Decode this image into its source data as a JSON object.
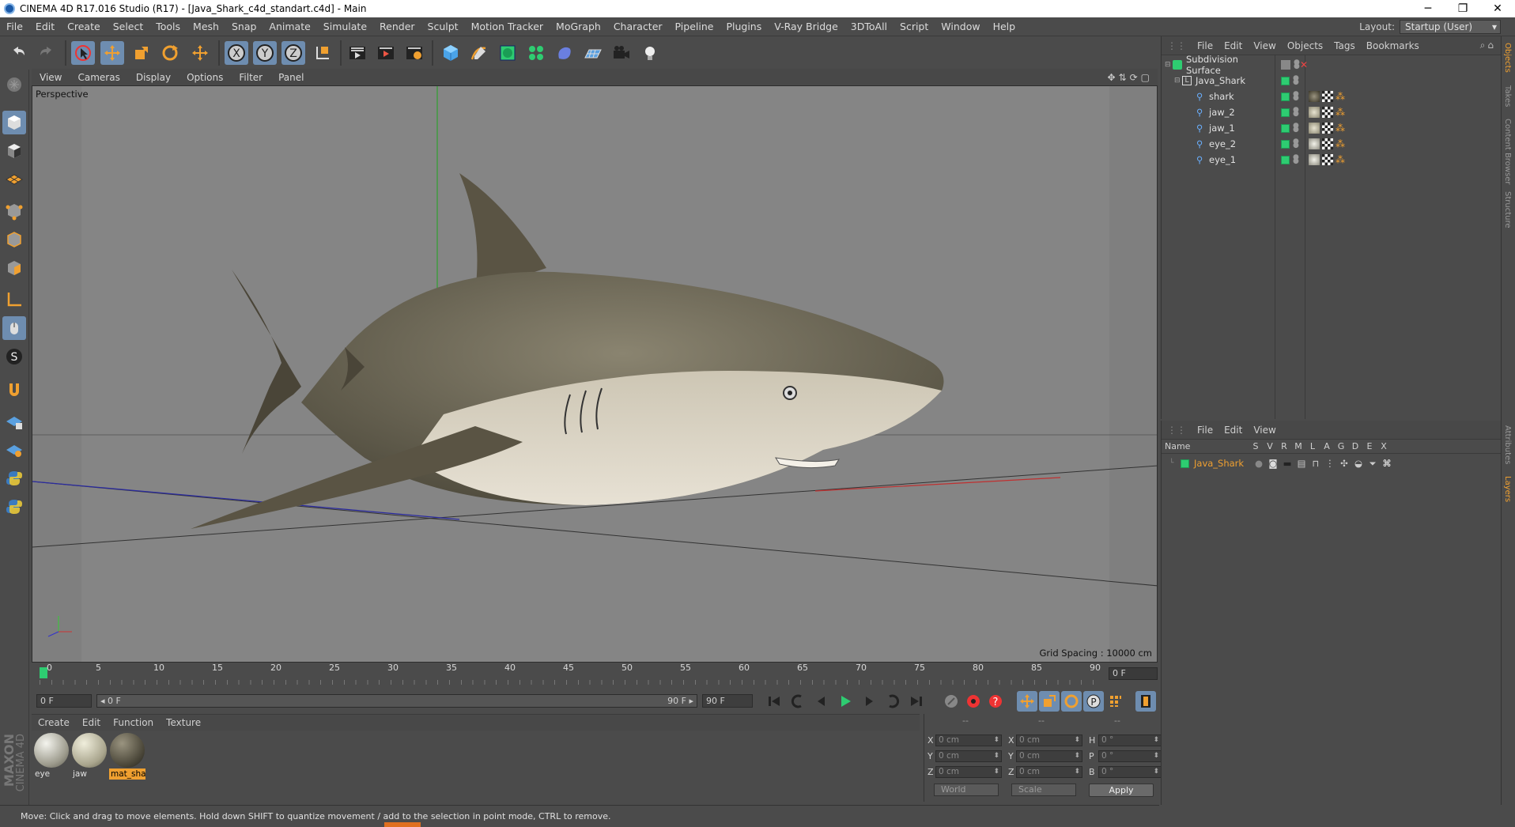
{
  "window": {
    "title": "CINEMA 4D R17.016 Studio (R17) - [Java_Shark_c4d_standart.c4d] - Main",
    "min": "─",
    "max": "❐",
    "close": "✕"
  },
  "menubar": [
    "File",
    "Edit",
    "Create",
    "Select",
    "Tools",
    "Mesh",
    "Snap",
    "Animate",
    "Simulate",
    "Render",
    "Sculpt",
    "Motion Tracker",
    "MoGraph",
    "Character",
    "Pipeline",
    "Plugins",
    "V-Ray Bridge",
    "3DToAll",
    "Script",
    "Window",
    "Help"
  ],
  "layout": {
    "label": "Layout:",
    "value": "Startup (User)"
  },
  "viewport": {
    "menu": [
      "View",
      "Cameras",
      "Display",
      "Options",
      "Filter",
      "Panel"
    ],
    "label": "Perspective",
    "grid": "Grid Spacing : 10000 cm"
  },
  "timeline": {
    "ticks": [
      "0",
      "5",
      "10",
      "15",
      "20",
      "25",
      "30",
      "35",
      "40",
      "45",
      "50",
      "55",
      "60",
      "65",
      "70",
      "75",
      "80",
      "85",
      "90"
    ],
    "current": "0 F"
  },
  "transport": {
    "start": "0 F",
    "range_start": "◂ 0 F",
    "range_end": "90 F ▸",
    "end": "90 F"
  },
  "materials": {
    "menu": [
      "Create",
      "Edit",
      "Function",
      "Texture"
    ],
    "items": [
      {
        "name": "eye"
      },
      {
        "name": "jaw"
      },
      {
        "name": "mat_sha"
      }
    ]
  },
  "coords": {
    "headers": [
      "--",
      "--",
      "--"
    ],
    "rows": [
      [
        "X",
        "0 cm",
        "X",
        "0 cm",
        "H",
        "0 °"
      ],
      [
        "Y",
        "0 cm",
        "Y",
        "0 cm",
        "P",
        "0 °"
      ],
      [
        "Z",
        "0 cm",
        "Z",
        "0 cm",
        "B",
        "0 °"
      ]
    ],
    "mode1": "World",
    "mode2": "Scale",
    "apply": "Apply"
  },
  "status": "Move: Click and drag to move elements. Hold down SHIFT to quantize movement / add to the selection in point mode, CTRL to remove.",
  "objects": {
    "menu": [
      "File",
      "Edit",
      "View",
      "Objects",
      "Tags",
      "Bookmarks"
    ],
    "items": [
      {
        "name": "Subdivision Surface",
        "level": 0
      },
      {
        "name": "Java_Shark",
        "level": 1
      },
      {
        "name": "shark",
        "level": 2
      },
      {
        "name": "jaw_2",
        "level": 2
      },
      {
        "name": "jaw_1",
        "level": 2
      },
      {
        "name": "eye_2",
        "level": 2
      },
      {
        "name": "eye_1",
        "level": 2
      }
    ]
  },
  "layers": {
    "menu": [
      "File",
      "Edit",
      "View"
    ],
    "columns": [
      "Name",
      "S",
      "V",
      "R",
      "M",
      "L",
      "A",
      "G",
      "D",
      "E",
      "X"
    ],
    "items": [
      {
        "name": "Java_Shark"
      }
    ]
  },
  "side_tabs": [
    "Objects",
    "Takes",
    "Content Browser",
    "Structure"
  ],
  "side_tabs2": [
    "Attributes",
    "Layers"
  ],
  "brand": {
    "maxon": "MAXON",
    "c4d": "CINEMA 4D"
  },
  "colors": {
    "accent": "#f0a030",
    "green": "#2ecc71",
    "active": "#6e8db0"
  }
}
